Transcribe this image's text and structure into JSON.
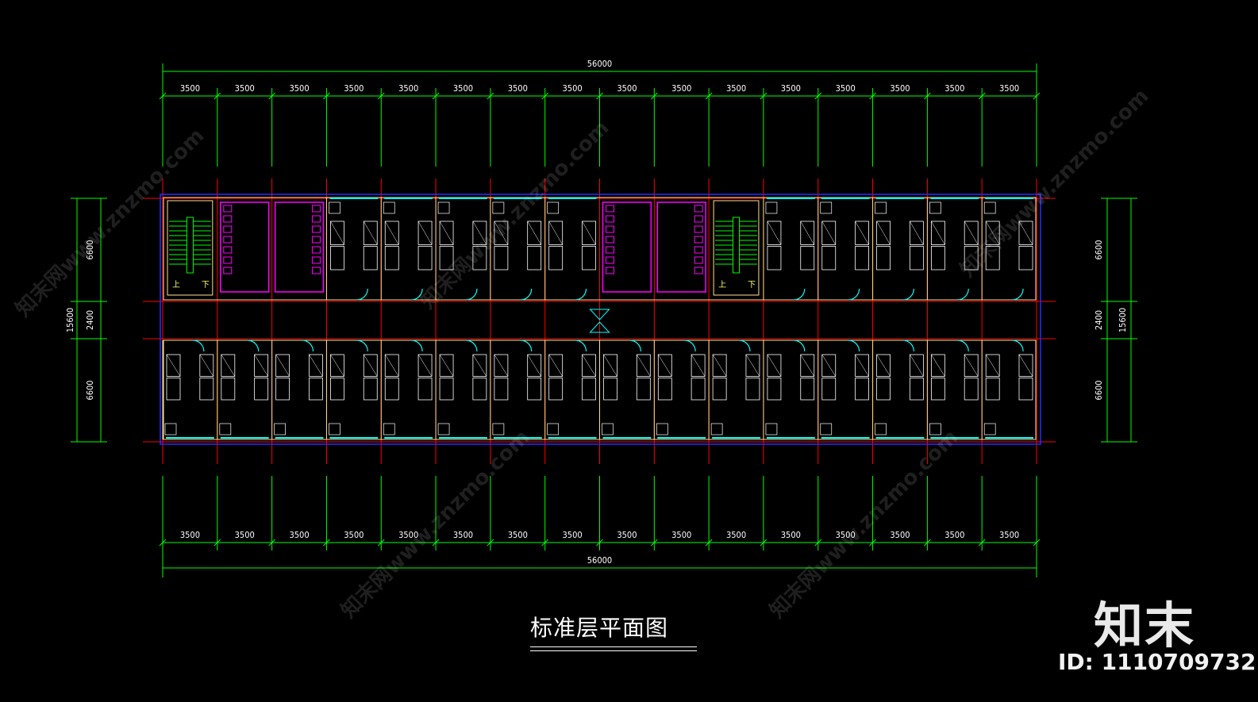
{
  "drawing": {
    "title": "标准层平面图",
    "total_length": "56000",
    "bay_width": "3500",
    "bay_count": 16,
    "depth_total": "15600",
    "depth_top": "6600",
    "depth_corridor": "2400",
    "depth_bottom": "6600",
    "stair_up": "上",
    "stair_down": "下"
  },
  "branding": {
    "logo": "知末",
    "id_label": "ID: 1110709732",
    "watermark": "知末网www.znzmo.com"
  },
  "colors": {
    "background": "#000000",
    "dimension": "#00ff00",
    "axis": "#ff0000",
    "wall": "#ffe08a",
    "door": "#00ffff",
    "toilet": "#ff00ff",
    "fixture": "#ffffff",
    "outline": "#2a2aff"
  }
}
